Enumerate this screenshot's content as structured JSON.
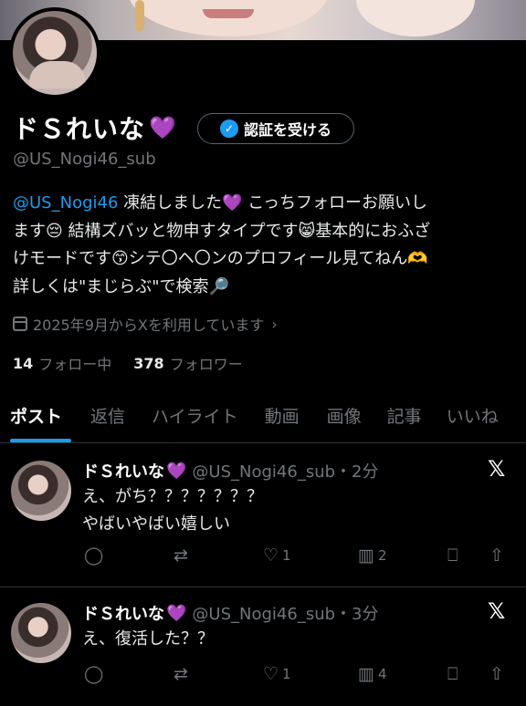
{
  "profile": {
    "name": "ドＳれいな",
    "name_emoji": "💜",
    "verify_button": "認証を受ける",
    "handle": "@US_Nogi46_sub",
    "bio_mention": "@US_Nogi46",
    "bio_line1": " 凍結しました💜 こっちフォローお願いし",
    "bio_line2": "ます😔 結構ズバッと物申すタイプです😸基本的におふざ",
    "bio_line3": "けモードです😙シテ〇ヘ〇ンのプロフィール見てねん🫶",
    "bio_line4": "詳しくは\"まじらぶ\"で検索🔎",
    "joined": "2025年9月からXを利用しています",
    "following_count": "14",
    "following_label": "フォロー中",
    "followers_count": "378",
    "followers_label": "フォロワー"
  },
  "tabs": [
    {
      "label": "ポスト",
      "active": true
    },
    {
      "label": "返信"
    },
    {
      "label": "ハイライト"
    },
    {
      "label": "動画"
    },
    {
      "label": "画像"
    },
    {
      "label": "記事"
    },
    {
      "label": "いいね"
    }
  ],
  "tweets": [
    {
      "name": "ドＳれいな",
      "emoji": "💜",
      "meta": "@US_Nogi46_sub・2分",
      "line1": "え、がち？？？？？？？",
      "line2": "やばいやばい嬉しい",
      "likes": "1",
      "views": "2"
    },
    {
      "name": "ドＳれいな",
      "emoji": "💜",
      "meta": "@US_Nogi46_sub・3分",
      "line1": "え、復活した？？",
      "line2": "",
      "likes": "1",
      "views": "4"
    }
  ],
  "icons": {
    "x_logo": "𝕏",
    "reply": "◯",
    "retweet": "⇄",
    "like": "♡",
    "views": "▥",
    "bookmark": "⎕",
    "share": "⇧",
    "verify_badge": "✓",
    "chevron": "›"
  }
}
